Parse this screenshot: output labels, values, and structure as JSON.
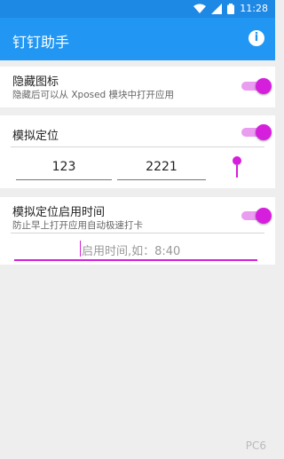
{
  "status": {
    "time": "11:28"
  },
  "appbar": {
    "title": "钉钉助手",
    "info_icon": "info-icon"
  },
  "hide_icon": {
    "title": "隐藏图标",
    "subtitle": "隐藏后可以从 Xposed 模块中打开应用",
    "enabled": true
  },
  "mock_location": {
    "title": "模拟定位",
    "enabled": true,
    "value1": "123",
    "value2": "2221"
  },
  "mock_time": {
    "title": "模拟定位启用时间",
    "subtitle": "防止早上打开应用自动极速打卡",
    "enabled": true,
    "placeholder": "启用时间,如：8:40"
  },
  "watermark": "PC6"
}
